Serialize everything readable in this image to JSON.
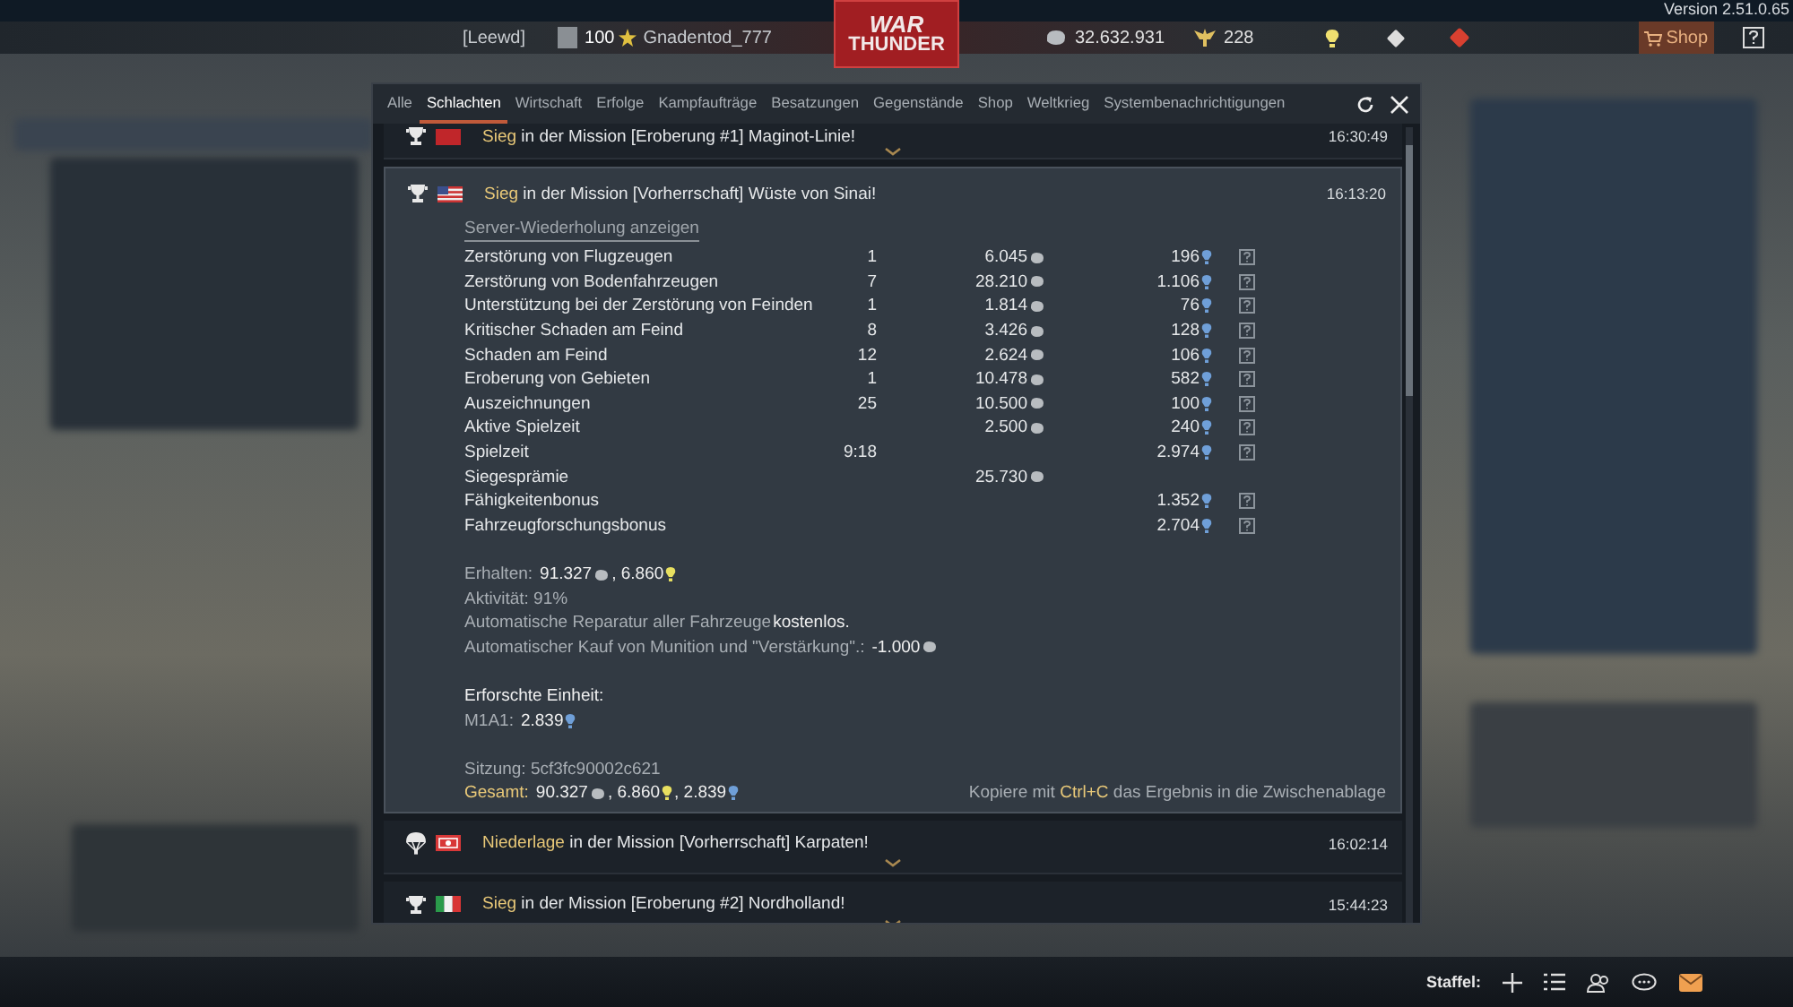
{
  "top_bar": {
    "version": "Version 2.51.0.65",
    "squad": "[Leewd]",
    "level": "100",
    "player": "Gnadentod_777",
    "logo": [
      "WAR",
      "THUNDER"
    ],
    "silver": "32.632.931",
    "gold": "228",
    "shop": "Shop"
  },
  "dialog": {
    "tabs": [
      {
        "label": "Alle",
        "selected": false
      },
      {
        "label": "Schlachten",
        "selected": true
      },
      {
        "label": "Wirtschaft",
        "selected": false
      },
      {
        "label": "Erfolge",
        "selected": false
      },
      {
        "label": "Kampfaufträge",
        "selected": false
      },
      {
        "label": "Besatzungen",
        "selected": false
      },
      {
        "label": "Gegenstände",
        "selected": false
      },
      {
        "label": "Shop",
        "selected": false
      },
      {
        "label": "Weltkrieg",
        "selected": false
      },
      {
        "label": "Systembenachrichtigungen",
        "selected": false
      }
    ],
    "messages": [
      {
        "kind": "victory",
        "outcome": "Sieg",
        "text": "in der Mission [Eroberung #1] Maginot-Linie!",
        "time": "16:30:49",
        "expanded": false
      },
      {
        "kind": "victory",
        "outcome": "Sieg",
        "text": "in der Mission [Vorherrschaft] Wüste von Sinai!",
        "time": "16:13:20",
        "expanded": true,
        "details": {
          "replay_link": "Server-Wiederholung anzeigen",
          "rows": [
            {
              "label": "Zerstörung von Flugzeugen",
              "count": "1",
              "silver": "6.045",
              "rp": "196",
              "help": true
            },
            {
              "label": "Zerstörung von Bodenfahrzeugen",
              "count": "7",
              "silver": "28.210",
              "rp": "1.106",
              "help": true
            },
            {
              "label": "Unterstützung bei der Zerstörung von Feinden",
              "count": "1",
              "silver": "1.814",
              "rp": "76",
              "help": true
            },
            {
              "label": "Kritischer Schaden am Feind",
              "count": "8",
              "silver": "3.426",
              "rp": "128",
              "help": true
            },
            {
              "label": "Schaden am Feind",
              "count": "12",
              "silver": "2.624",
              "rp": "106",
              "help": true
            },
            {
              "label": "Eroberung von Gebieten",
              "count": "1",
              "silver": "10.478",
              "rp": "582",
              "help": true
            },
            {
              "label": "Auszeichnungen",
              "count": "25",
              "silver": "10.500",
              "rp": "100",
              "help": true
            },
            {
              "label": "Aktive Spielzeit",
              "count": "",
              "silver": "2.500",
              "rp": "240",
              "help": true
            },
            {
              "label": "Spielzeit",
              "count": "9:18",
              "silver": "",
              "rp": "2.974",
              "help": true
            },
            {
              "label": "Siegesprämie",
              "count": "",
              "silver": "25.730",
              "rp": "",
              "help": false
            },
            {
              "label": "Fähigkeitenbonus",
              "count": "",
              "silver": "",
              "rp": "1.352",
              "help": true
            },
            {
              "label": "Fahrzeugforschungsbonus",
              "count": "",
              "silver": "",
              "rp": "2.704",
              "help": true
            }
          ],
          "summary": [
            [
              [
                {
                  "kind": "label",
                  "text": "Erhalten:"
                },
                {
                  "kind": "silver",
                  "text": "91.327"
                },
                {
                  "kind": "bonus",
                  "text": ", 6.860"
                }
              ],
              [
                {
                  "kind": "label",
                  "text": "Aktivität: 91%"
                }
              ],
              [
                {
                  "kind": "label",
                  "text": "Automatische Reparatur aller Fahrzeuge"
                },
                {
                  "kind": "value",
                  "text": "kostenlos."
                }
              ],
              [
                {
                  "kind": "label",
                  "text": "Automatischer Kauf von Munition und \"Verstärkung\".:"
                },
                {
                  "kind": "silver",
                  "text": "-1.000"
                }
              ]
            ],
            [
              [
                {
                  "kind": "value",
                  "text": "Erforschte Einheit:"
                }
              ],
              [
                {
                  "kind": "label",
                  "text": "M1A1:"
                },
                {
                  "kind": "research",
                  "text": "2.839"
                }
              ]
            ],
            [
              [
                {
                  "kind": "label",
                  "text": "Sitzung: 5cf3fc90002c621"
                }
              ],
              [
                {
                  "kind": "accent",
                  "text": "Gesamt:"
                },
                {
                  "kind": "silver",
                  "text": "90.327"
                },
                {
                  "kind": "bonus",
                  "text": ", 6.860"
                },
                {
                  "kind": "research",
                  "text": ", 2.839"
                }
              ]
            ]
          ],
          "hint": [
            {
              "kind": "label",
              "text": "Kopiere mit"
            },
            {
              "kind": "accent",
              "text": "Ctrl+C"
            },
            {
              "kind": "label",
              "text": "das Ergebnis in die Zwischenablage"
            }
          ]
        }
      },
      {
        "kind": "defeat",
        "outcome": "Niederlage",
        "text": "in der Mission [Vorherrschaft] Karpaten!",
        "time": "16:02:14",
        "expanded": false
      },
      {
        "kind": "victory",
        "outcome": "Sieg",
        "text": "in der Mission [Eroberung #2] Nordholland!",
        "time": "15:44:23",
        "expanded": false
      }
    ]
  },
  "bottom_bar": {
    "squad_label": "Staffel:"
  }
}
